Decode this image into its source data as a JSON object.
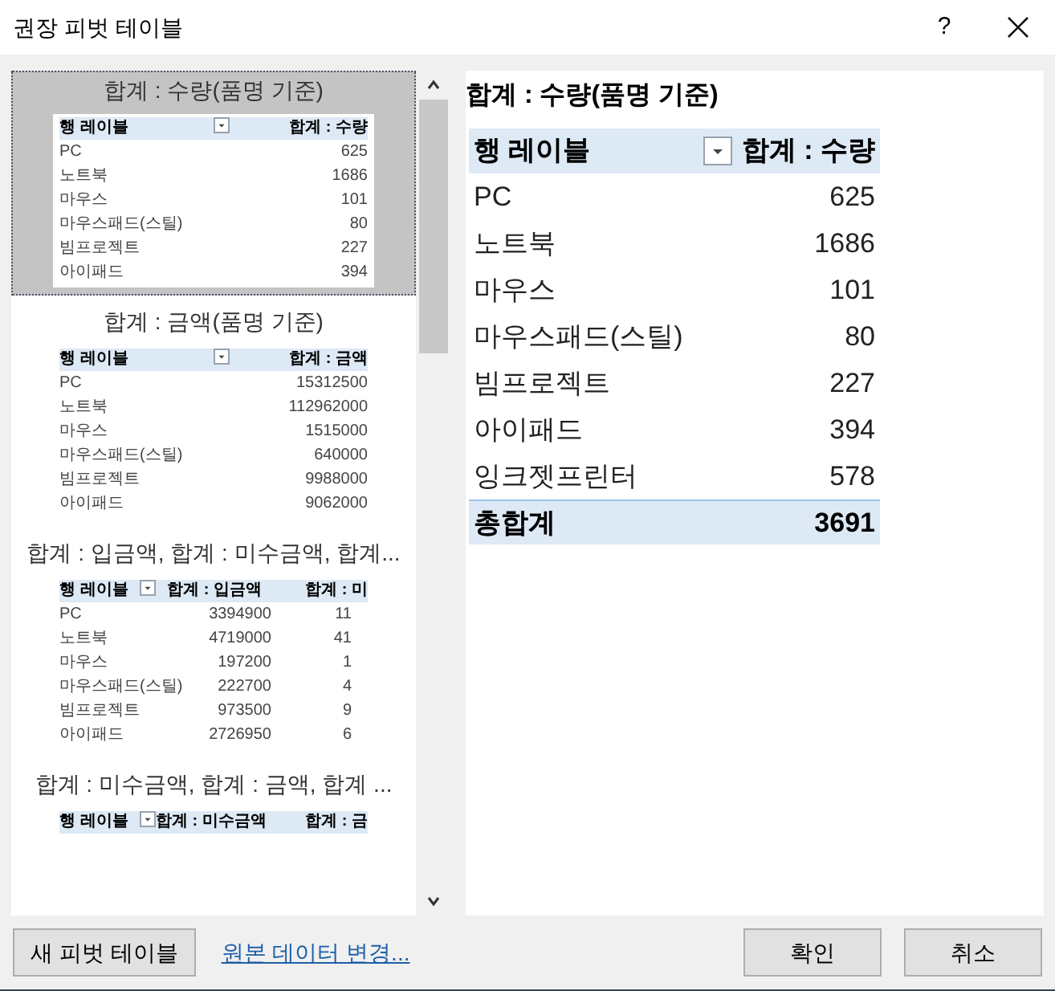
{
  "window": {
    "title": "권장 피벗 테이블",
    "help": "?"
  },
  "thumbnails": [
    {
      "caption": "합계 : 수량(품명 기준)",
      "selected": true,
      "columns": [
        "행 레이블",
        "합계 : 수량"
      ],
      "rows": [
        [
          "PC",
          "625"
        ],
        [
          "노트북",
          "1686"
        ],
        [
          "마우스",
          "101"
        ],
        [
          "마우스패드(스틸)",
          "80"
        ],
        [
          "빔프로젝트",
          "227"
        ],
        [
          "아이패드",
          "394"
        ]
      ]
    },
    {
      "caption": "합계 : 금액(품명 기준)",
      "selected": false,
      "columns": [
        "행 레이블",
        "합계 : 금액"
      ],
      "rows": [
        [
          "PC",
          "15312500"
        ],
        [
          "노트북",
          "112962000"
        ],
        [
          "마우스",
          "1515000"
        ],
        [
          "마우스패드(스틸)",
          "640000"
        ],
        [
          "빔프로젝트",
          "9988000"
        ],
        [
          "아이패드",
          "9062000"
        ]
      ]
    },
    {
      "caption": "합계 : 입금액, 합계 : 미수금액, 합계...",
      "selected": false,
      "columns": [
        "행 레이블",
        "합계 : 입금액",
        "합계 : 미"
      ],
      "rows": [
        [
          "PC",
          "3394900",
          "11"
        ],
        [
          "노트북",
          "4719000",
          "41"
        ],
        [
          "마우스",
          "197200",
          "1"
        ],
        [
          "마우스패드(스틸)",
          "222700",
          "4"
        ],
        [
          "빔프로젝트",
          "973500",
          "9"
        ],
        [
          "아이패드",
          "2726950",
          "6"
        ]
      ]
    },
    {
      "caption": "합계 : 미수금액, 합계 : 금액, 합계 ...",
      "selected": false,
      "columns": [
        "행 레이블",
        "합계 : 미수금액",
        "합계 : 금"
      ]
    }
  ],
  "preview": {
    "title": "합계 : 수량(품명 기준)",
    "columns": [
      "행 레이블",
      "합계 : 수량"
    ],
    "rows": [
      [
        "PC",
        "625"
      ],
      [
        "노트북",
        "1686"
      ],
      [
        "마우스",
        "101"
      ],
      [
        "마우스패드(스틸)",
        "80"
      ],
      [
        "빔프로젝트",
        "227"
      ],
      [
        "아이패드",
        "394"
      ],
      [
        "잉크젯프린터",
        "578"
      ]
    ],
    "total": [
      "총합계",
      "3691"
    ]
  },
  "buttons": {
    "new_pivot": "새 피벗 테이블",
    "change_source": "원본 데이터 변경...",
    "ok": "확인",
    "cancel": "취소"
  }
}
